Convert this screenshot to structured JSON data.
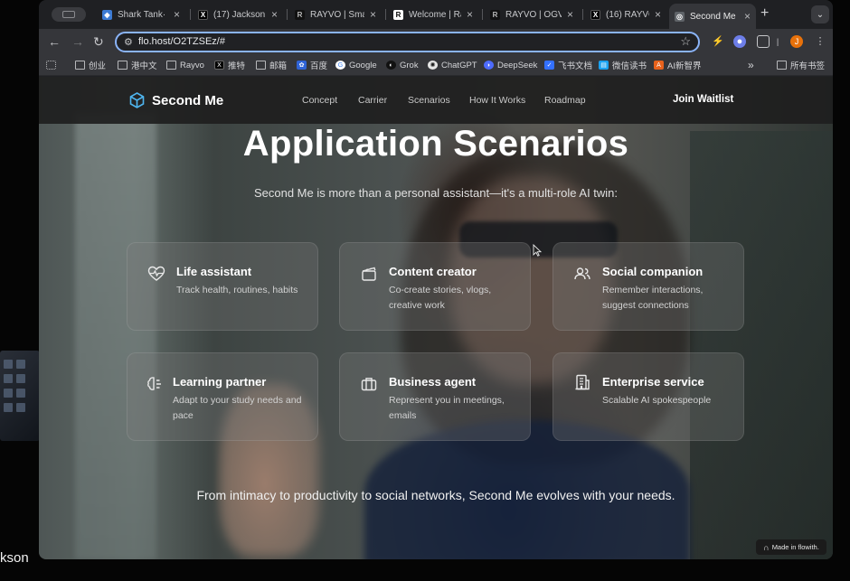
{
  "outside": {
    "name_fragment": "kson"
  },
  "browser": {
    "tabs": [
      {
        "title": "Shark Tank·",
        "favicon": "shield"
      },
      {
        "title": "(17) Jackson",
        "favicon": "x"
      },
      {
        "title": "RAYVO | Sma",
        "favicon": "r"
      },
      {
        "title": "Welcome | Ra",
        "favicon": "r-box"
      },
      {
        "title": "RAYVO | OGV",
        "favicon": "r"
      },
      {
        "title": "(16) RAYVO |",
        "favicon": "x"
      },
      {
        "title": "Second Me |",
        "favicon": "globe",
        "active": true
      }
    ],
    "url": "flo.host/O2TZSEz/#",
    "bookmarks": [
      {
        "label": "创业",
        "icon": "folder"
      },
      {
        "label": "港中文",
        "icon": "folder"
      },
      {
        "label": "Rayvo",
        "icon": "folder"
      },
      {
        "label": "推特",
        "icon": "x"
      },
      {
        "label": "邮箱",
        "icon": "folder"
      },
      {
        "label": "百度",
        "icon": "baidu"
      },
      {
        "label": "Google",
        "icon": "google"
      },
      {
        "label": "Grok",
        "icon": "grok"
      },
      {
        "label": "ChatGPT",
        "icon": "chatgpt"
      },
      {
        "label": "DeepSeek",
        "icon": "deepseek"
      },
      {
        "label": "飞书文档",
        "icon": "feishu"
      },
      {
        "label": "微信读书",
        "icon": "weread"
      },
      {
        "label": "AI新智界",
        "icon": "ai"
      }
    ],
    "bookmarks_more": "»",
    "all_bookmarks": "所有书签",
    "profile_initial": "J"
  },
  "site": {
    "brand": "Second Me",
    "nav": [
      "Concept",
      "Carrier",
      "Scenarios",
      "How It Works",
      "Roadmap"
    ],
    "cta": "Join Waitlist",
    "title": "Application Scenarios",
    "subtitle": "Second Me is more than a personal assistant—it's a multi-role AI twin:",
    "cards": [
      {
        "icon": "heart-pulse-icon",
        "title": "Life assistant",
        "desc": "Track health, routines, habits"
      },
      {
        "icon": "clapperboard-icon",
        "title": "Content creator",
        "desc": "Co-create stories, vlogs, creative work"
      },
      {
        "icon": "users-icon",
        "title": "Social companion",
        "desc": "Remember interactions, suggest connections"
      },
      {
        "icon": "brain-icon",
        "title": "Learning partner",
        "desc": "Adapt to your study needs and pace"
      },
      {
        "icon": "briefcase-icon",
        "title": "Business agent",
        "desc": "Represent you in meetings, emails"
      },
      {
        "icon": "building-icon",
        "title": "Enterprise service",
        "desc": "Scalable AI spokespeople"
      }
    ],
    "closing": "From intimacy to productivity to social networks, Second Me evolves with your needs.",
    "badge": "Made in flowith."
  }
}
